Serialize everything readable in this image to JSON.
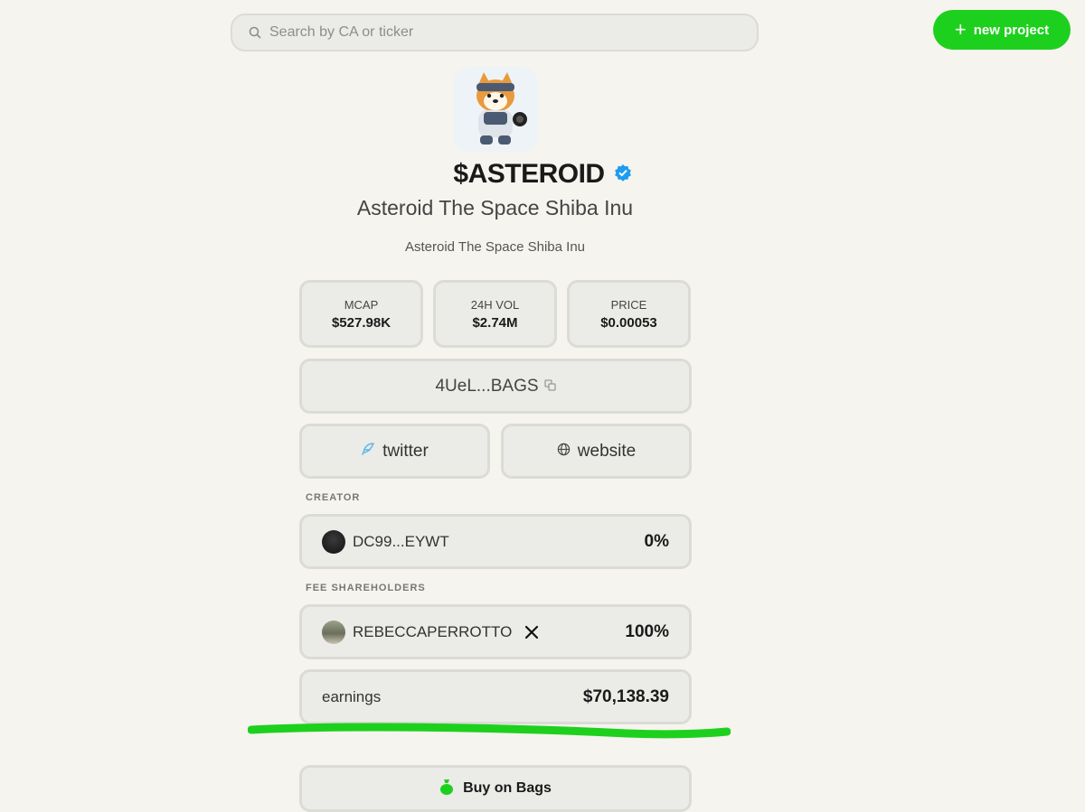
{
  "search": {
    "placeholder": "Search by CA or ticker"
  },
  "header": {
    "new_project_label": "new project"
  },
  "token": {
    "ticker": "$ASTEROID",
    "name": "Asteroid The Space Shiba Inu",
    "description": "Asteroid The Space Shiba Inu"
  },
  "stats": [
    {
      "label": "MCAP",
      "value": "$527.98K"
    },
    {
      "label": "24H VOL",
      "value": "$2.74M"
    },
    {
      "label": "PRICE",
      "value": "$0.00053"
    }
  ],
  "contract": {
    "short": "4UeL...BAGS"
  },
  "links": {
    "twitter": "twitter",
    "website": "website"
  },
  "creator": {
    "section_label": "CREATOR",
    "address": "DC99...EYWT",
    "share": "0%"
  },
  "fee_shareholders": {
    "section_label": "FEE SHAREHOLDERS",
    "name": "REBECCAPERROTTO",
    "share": "100%"
  },
  "earnings": {
    "label": "earnings",
    "value": "$70,138.39"
  },
  "buy": {
    "label": "Buy on Bags"
  },
  "colors": {
    "accent": "#1ed01e",
    "verified": "#1d9bf0",
    "background": "#f5f4ee"
  }
}
